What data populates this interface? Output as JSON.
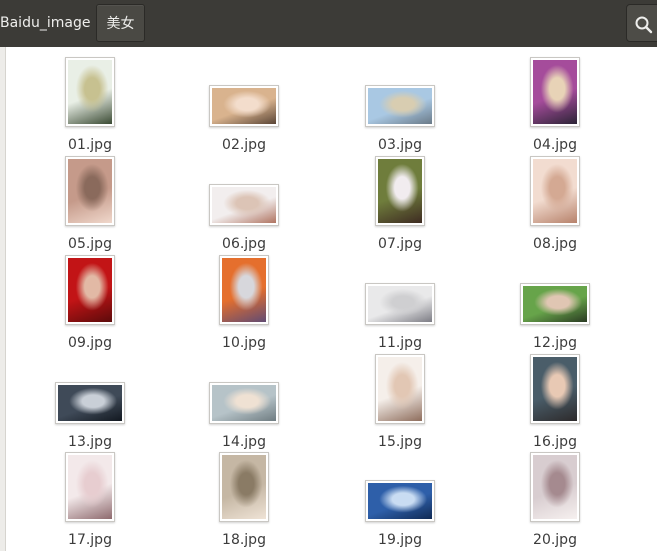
{
  "breadcrumb": {
    "parent": "Baidu_image",
    "current": "美女"
  },
  "toolbar": {
    "search_icon": "search-icon"
  },
  "files": [
    {
      "name": "01.jpg",
      "orientation": "portrait",
      "palette": [
        "#e9efe6",
        "#c7c190",
        "#3a4a33"
      ]
    },
    {
      "name": "02.jpg",
      "orientation": "landscape",
      "palette": [
        "#d9b38e",
        "#f3ddcc",
        "#5a4536"
      ]
    },
    {
      "name": "03.jpg",
      "orientation": "landscape",
      "palette": [
        "#a9c8e3",
        "#d8cdb1",
        "#6a7a88"
      ]
    },
    {
      "name": "04.jpg",
      "orientation": "portrait",
      "palette": [
        "#a54c9b",
        "#e8d3b7",
        "#2c2436"
      ]
    },
    {
      "name": "05.jpg",
      "orientation": "portrait",
      "palette": [
        "#c59a8a",
        "#8a6a5c",
        "#f0d8cc"
      ]
    },
    {
      "name": "06.jpg",
      "orientation": "landscape",
      "palette": [
        "#f2eeee",
        "#dcc4b6",
        "#b07461"
      ]
    },
    {
      "name": "07.jpg",
      "orientation": "portrait",
      "palette": [
        "#6f7d3c",
        "#f1ecef",
        "#3e2b22"
      ]
    },
    {
      "name": "08.jpg",
      "orientation": "portrait",
      "palette": [
        "#f2dcd0",
        "#d4a993",
        "#b7826b"
      ]
    },
    {
      "name": "09.jpg",
      "orientation": "portrait",
      "palette": [
        "#c21416",
        "#e2b9a5",
        "#5c0b0b"
      ]
    },
    {
      "name": "10.jpg",
      "orientation": "portrait",
      "palette": [
        "#e56f2d",
        "#d7d7dc",
        "#614b73"
      ]
    },
    {
      "name": "11.jpg",
      "orientation": "landscape",
      "palette": [
        "#e9e9ea",
        "#cfcfd1",
        "#7c7c84"
      ]
    },
    {
      "name": "12.jpg",
      "orientation": "landscape",
      "palette": [
        "#67a44a",
        "#e0c6b3",
        "#2a3a22"
      ]
    },
    {
      "name": "13.jpg",
      "orientation": "landscape",
      "palette": [
        "#3f4a58",
        "#c9cfd7",
        "#121820"
      ]
    },
    {
      "name": "14.jpg",
      "orientation": "landscape",
      "palette": [
        "#b6c3c8",
        "#efe1d3",
        "#6f7c81"
      ]
    },
    {
      "name": "15.jpg",
      "orientation": "portrait",
      "palette": [
        "#f5efea",
        "#e2c7b4",
        "#8e6d5c"
      ]
    },
    {
      "name": "16.jpg",
      "orientation": "portrait",
      "palette": [
        "#4a5d69",
        "#e8c9b4",
        "#2d2a2b"
      ]
    },
    {
      "name": "17.jpg",
      "orientation": "portrait",
      "palette": [
        "#f3e9ea",
        "#e7cdd0",
        "#8e6a6e"
      ]
    },
    {
      "name": "18.jpg",
      "orientation": "portrait",
      "palette": [
        "#c5b7a4",
        "#8a7b65",
        "#efe3d6"
      ]
    },
    {
      "name": "19.jpg",
      "orientation": "landscape",
      "palette": [
        "#2e5fa9",
        "#c9dcf2",
        "#102a54"
      ]
    },
    {
      "name": "20.jpg",
      "orientation": "portrait",
      "palette": [
        "#d8cdd0",
        "#a58a8f",
        "#f6f0ef"
      ]
    }
  ]
}
